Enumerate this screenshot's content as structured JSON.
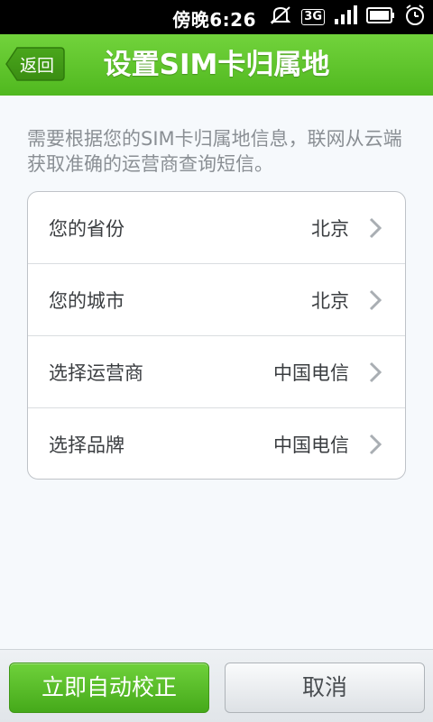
{
  "status_bar": {
    "time": "傍晚6:26",
    "network": "3G",
    "icons": [
      "mute-icon",
      "3g-icon",
      "signal-icon",
      "battery-icon",
      "alarm-icon"
    ]
  },
  "header": {
    "back_label": "返回",
    "title": "设置SIM卡归属地"
  },
  "intro_text": "需要根据您的SIM卡归属地信息，联网从云端获取准确的运营商查询短信。",
  "settings": [
    {
      "label": "您的省份",
      "value": "北京"
    },
    {
      "label": "您的城市",
      "value": "北京"
    },
    {
      "label": "选择运营商",
      "value": "中国电信"
    },
    {
      "label": "选择品牌",
      "value": "中国电信"
    }
  ],
  "footer": {
    "primary_label": "立即自动校正",
    "secondary_label": "取消"
  },
  "colors": {
    "accent_green": "#5cc22a",
    "background": "#f6f9fc"
  }
}
